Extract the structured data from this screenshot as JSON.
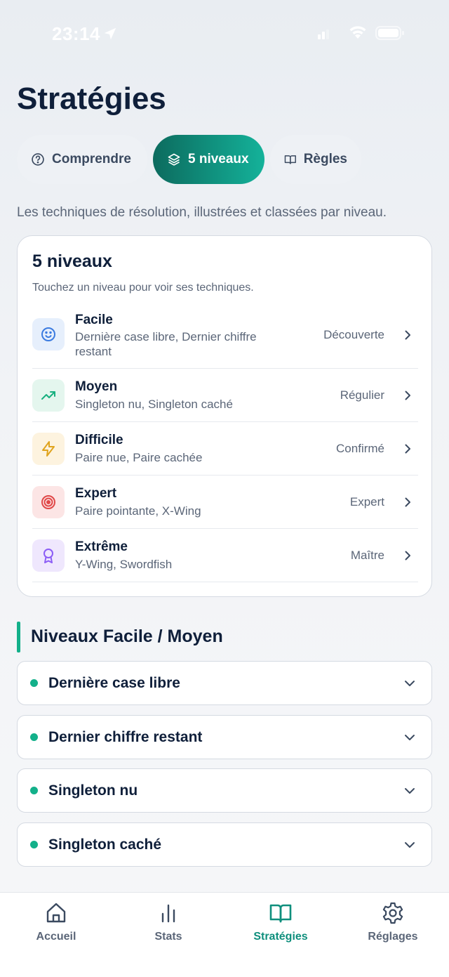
{
  "status": {
    "time": "23:14"
  },
  "page": {
    "title": "Stratégies",
    "subtitle": "Les techniques de résolution, illustrées et classées par niveau."
  },
  "tabs": [
    {
      "label": "Comprendre",
      "icon": "help-circle-icon",
      "active": false
    },
    {
      "label": "5 niveaux",
      "icon": "layers-icon",
      "active": true
    },
    {
      "label": "Règles",
      "icon": "book-open-icon",
      "active": false
    }
  ],
  "levels_card": {
    "title": "5 niveaux",
    "hint": "Touchez un niveau pour voir ses techniques.",
    "levels": [
      {
        "name": "Facile",
        "techniques": "Dernière case libre, Dernier chiffre restant",
        "tag": "Découverte",
        "icon": "smile-icon",
        "color": "#3b7be0"
      },
      {
        "name": "Moyen",
        "techniques": "Singleton nu, Singleton caché",
        "tag": "Régulier",
        "icon": "trending-up-icon",
        "color": "#17b07f"
      },
      {
        "name": "Difficile",
        "techniques": "Paire nue, Paire cachée",
        "tag": "Confirmé",
        "icon": "lightning-icon",
        "color": "#e0a41e"
      },
      {
        "name": "Expert",
        "techniques": "Paire pointante, X-Wing",
        "tag": "Expert",
        "icon": "target-icon",
        "color": "#e04848"
      },
      {
        "name": "Extrême",
        "techniques": "Y-Wing, Swordfish",
        "tag": "Maître",
        "icon": "award-icon",
        "color": "#8b5cf6"
      }
    ]
  },
  "section": {
    "title": "Niveaux Facile / Moyen",
    "items": [
      {
        "label": "Dernière case libre"
      },
      {
        "label": "Dernier chiffre restant"
      },
      {
        "label": "Singleton nu"
      },
      {
        "label": "Singleton caché"
      }
    ]
  },
  "nav": [
    {
      "label": "Accueil",
      "icon": "home-icon",
      "active": false
    },
    {
      "label": "Stats",
      "icon": "bar-chart-icon",
      "active": false
    },
    {
      "label": "Stratégies",
      "icon": "book-open-icon",
      "active": true
    },
    {
      "label": "Réglages",
      "icon": "gear-icon",
      "active": false
    }
  ],
  "colors": {
    "accent": "#13b08a",
    "accent_dark": "#0c6b5e",
    "text": "#0f1f3a",
    "muted": "#5b6678"
  }
}
